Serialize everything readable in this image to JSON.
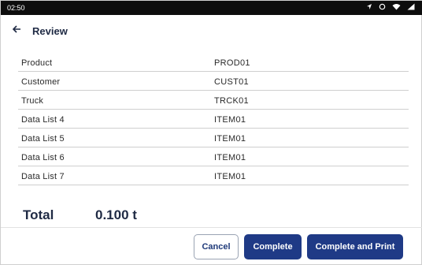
{
  "status_bar": {
    "time": "02:50",
    "icons": [
      "location-icon",
      "sync-icon",
      "wifi-icon",
      "signal-icon"
    ]
  },
  "header": {
    "back_icon": "arrow-left-icon",
    "title": "Review"
  },
  "details": [
    {
      "label": "Product",
      "value": "PROD01"
    },
    {
      "label": "Customer",
      "value": "CUST01"
    },
    {
      "label": "Truck",
      "value": "TRCK01"
    },
    {
      "label": "Data List 4",
      "value": "ITEM01"
    },
    {
      "label": "Data List 5",
      "value": "ITEM01"
    },
    {
      "label": "Data List 6",
      "value": "ITEM01"
    },
    {
      "label": "Data List 7",
      "value": "ITEM01"
    }
  ],
  "total": {
    "label": "Total",
    "value": "0.100 t"
  },
  "actions": {
    "cancel": "Cancel",
    "complete": "Complete",
    "complete_and_print": "Complete and Print"
  },
  "colors": {
    "primary": "#1f3a86",
    "title_text": "#1f2a44",
    "statusbar_bg": "#0d0d0d"
  }
}
